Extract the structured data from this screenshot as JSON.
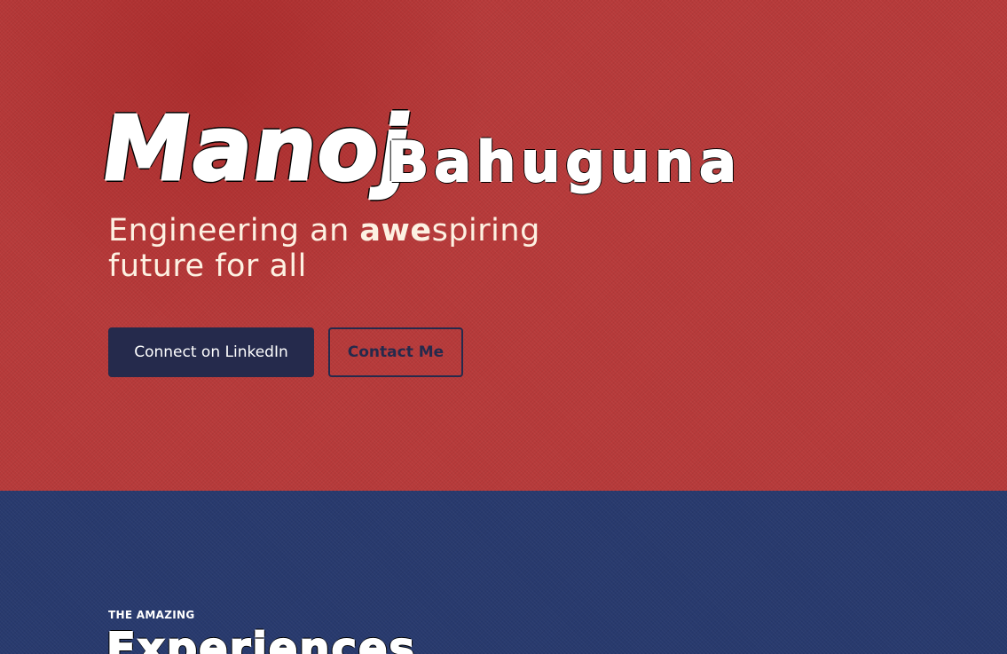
{
  "hero": {
    "name_first": "Manoj",
    "name_last": "Bahuguna",
    "tagline_prefix": "Engineering an ",
    "tagline_bold": "awe",
    "tagline_suffix": "spiring",
    "tagline_line2": "future for all",
    "buttons": {
      "linkedin_label": "Connect on LinkedIn",
      "contact_label": "Contact Me"
    }
  },
  "experiences": {
    "eyebrow": "THE AMAZING",
    "title": "Experiences"
  },
  "colors": {
    "hero_bg": "#b73a3a",
    "section_bg": "#283a6e",
    "button_dark": "#252a4c",
    "tagline": "#fdf1e2"
  }
}
